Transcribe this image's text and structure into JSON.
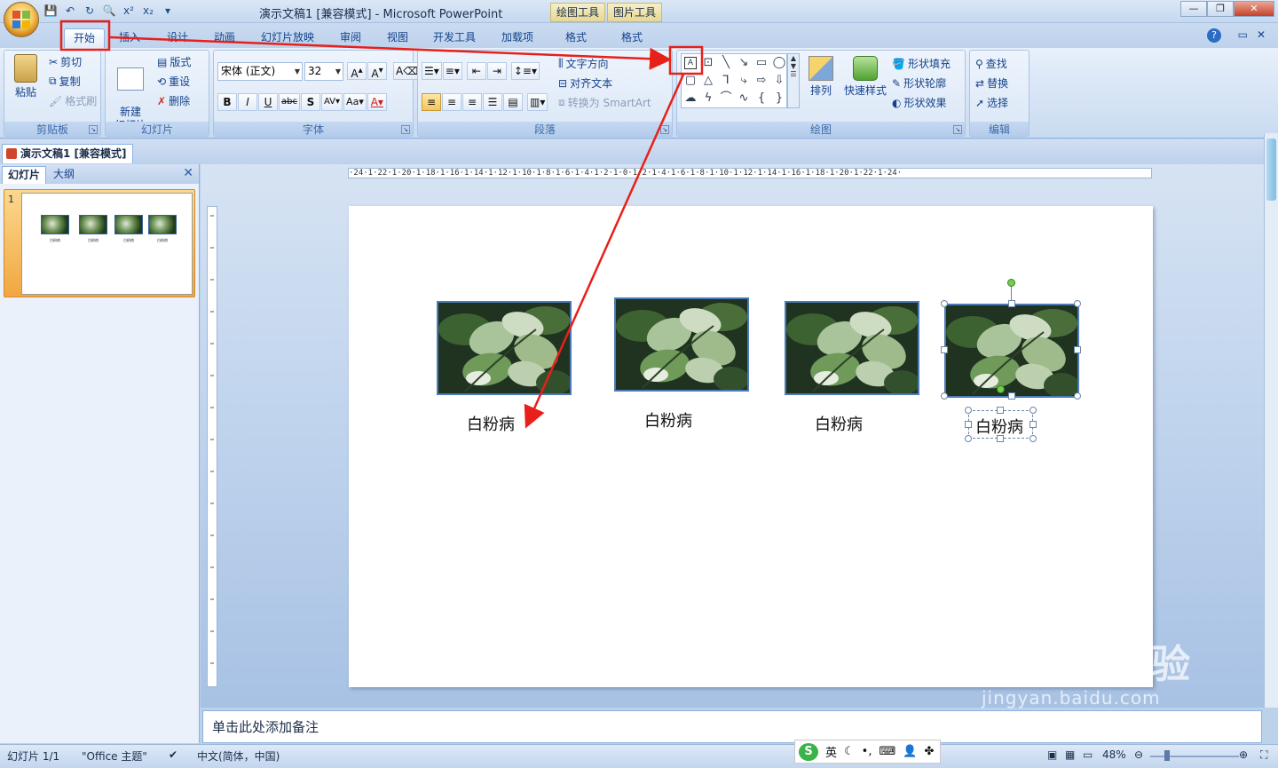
{
  "window": {
    "title": "演示文稿1 [兼容模式] - Microsoft PowerPoint",
    "context_tabs": [
      "绘图工具",
      "图片工具"
    ]
  },
  "ribbon_tabs": [
    "开始",
    "插入",
    "设计",
    "动画",
    "幻灯片放映",
    "审阅",
    "视图",
    "开发工具",
    "加载项",
    "格式",
    "格式"
  ],
  "clipboard": {
    "paste": "粘贴",
    "cut": "剪切",
    "copy": "复制",
    "format_painter": "格式刷",
    "label": "剪贴板"
  },
  "slides_group": {
    "new_slide": "新建\n幻灯片",
    "layout": "版式",
    "reset": "重设",
    "delete": "删除",
    "label": "幻灯片"
  },
  "font_group": {
    "font_name": "宋体 (正文)",
    "font_size": "32",
    "label": "字体"
  },
  "paragraph_group": {
    "text_direction": "文字方向",
    "align_text": "对齐文本",
    "convert_smartart": "转换为 SmartArt",
    "label": "段落"
  },
  "drawing_group": {
    "arrange": "排列",
    "quick_styles": "快速样式",
    "shape_fill": "形状填充",
    "shape_outline": "形状轮廓",
    "shape_effects": "形状效果",
    "label": "绘图"
  },
  "editing_group": {
    "find": "查找",
    "replace": "替换",
    "select": "选择",
    "label": "编辑"
  },
  "document_tab": "演示文稿1 [兼容模式]",
  "left_pane": {
    "tab_slides": "幻灯片",
    "tab_outline": "大纲",
    "slide_number": "1"
  },
  "slide": {
    "captions": [
      "白粉病",
      "白粉病",
      "白粉病",
      "白粉病"
    ]
  },
  "ruler": {
    "h": "·24·1·22·1·20·1·18·1·16·1·14·1·12·1·10·1·8·1·6·1·4·1·2·1·0·1·2·1·4·1·6·1·8·1·10·1·12·1·14·1·16·1·18·1·20·1·22·1·24·"
  },
  "notes_placeholder": "单击此处添加备注",
  "status": {
    "slide_count": "幻灯片 1/1",
    "theme": "\"Office 主题\"",
    "language": "中文(简体，中国)",
    "zoom": "48%",
    "ime_lang": "英"
  },
  "watermark": {
    "big": "Baidu经验",
    "small": "jingyan.baidu.com"
  },
  "colors": {
    "annotation_red": "#e8201a"
  }
}
